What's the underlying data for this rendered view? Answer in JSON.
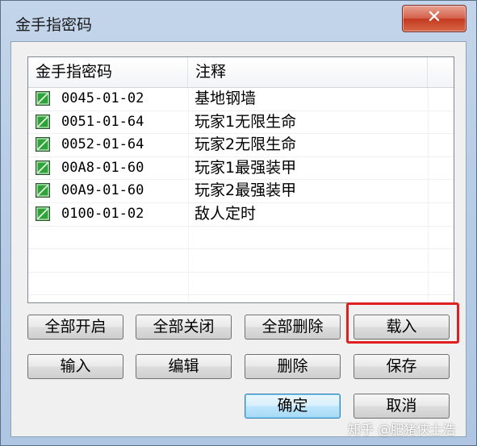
{
  "window": {
    "title": "金手指密码",
    "close_label": "✕"
  },
  "list": {
    "headers": [
      "金手指密码",
      "注释"
    ],
    "rows": [
      {
        "code": "0045-01-02",
        "note": "基地钢墙",
        "checked": true
      },
      {
        "code": "0051-01-64",
        "note": "玩家1无限生命",
        "checked": true
      },
      {
        "code": "0052-01-64",
        "note": "玩家2无限生命",
        "checked": true
      },
      {
        "code": "00A8-01-60",
        "note": "玩家1最强装甲",
        "checked": true
      },
      {
        "code": "00A9-01-60",
        "note": "玩家2最强装甲",
        "checked": true
      },
      {
        "code": "0100-01-02",
        "note": "敌人定时",
        "checked": true
      }
    ]
  },
  "buttons": {
    "enable_all": "全部开启",
    "disable_all": "全部关闭",
    "delete_all": "全部删除",
    "load": "载入",
    "input": "输入",
    "edit": "编辑",
    "delete": "删除",
    "save": "保存",
    "ok": "确定",
    "cancel": "取消"
  },
  "watermark": "知乎 @肥猪侠士浩",
  "colors": {
    "highlight": "#e02020",
    "checkbox": "#2fa33a"
  }
}
